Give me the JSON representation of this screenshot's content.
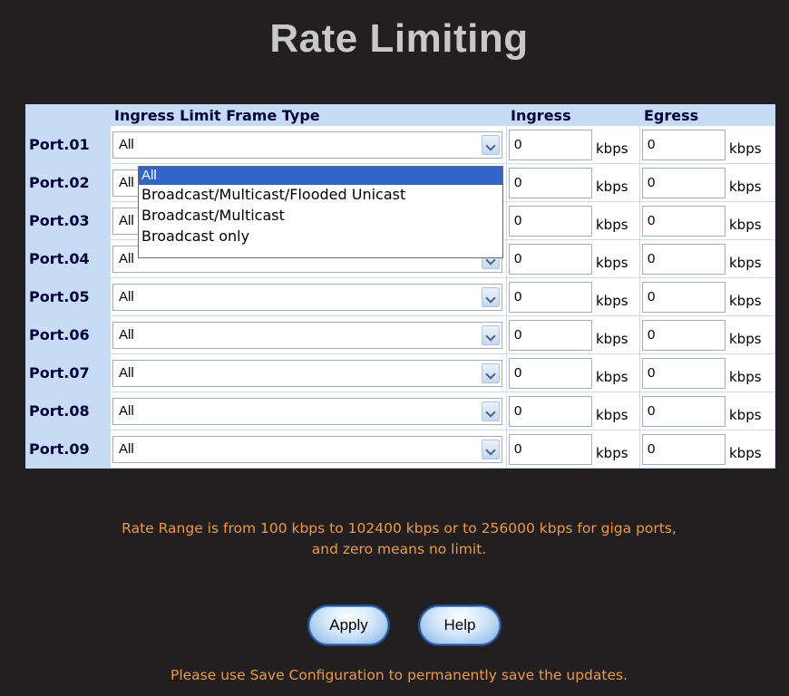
{
  "title": "Rate Limiting",
  "table": {
    "headers": {
      "port": "",
      "frame_type": "Ingress Limit Frame Type",
      "ingress": "Ingress",
      "egress": "Egress"
    },
    "unit": "kbps",
    "rows": [
      {
        "port": "Port.01",
        "frame_type": "All",
        "ingress": "0",
        "egress": "0"
      },
      {
        "port": "Port.02",
        "frame_type": "All",
        "ingress": "0",
        "egress": "0"
      },
      {
        "port": "Port.03",
        "frame_type": "All",
        "ingress": "0",
        "egress": "0"
      },
      {
        "port": "Port.04",
        "frame_type": "All",
        "ingress": "0",
        "egress": "0"
      },
      {
        "port": "Port.05",
        "frame_type": "All",
        "ingress": "0",
        "egress": "0"
      },
      {
        "port": "Port.06",
        "frame_type": "All",
        "ingress": "0",
        "egress": "0"
      },
      {
        "port": "Port.07",
        "frame_type": "All",
        "ingress": "0",
        "egress": "0"
      },
      {
        "port": "Port.08",
        "frame_type": "All",
        "ingress": "0",
        "egress": "0"
      },
      {
        "port": "Port.09",
        "frame_type": "All",
        "ingress": "0",
        "egress": "0"
      }
    ]
  },
  "dropdown": {
    "open_for_row": 0,
    "options": [
      "All",
      "Broadcast/Multicast/Flooded Unicast",
      "Broadcast/Multicast",
      "Broadcast only"
    ],
    "selected_index": 0
  },
  "note_line1": "Rate Range is from 100 kbps to 102400 kbps or to 256000 kbps for giga ports,",
  "note_line2": "and zero means no limit.",
  "buttons": {
    "apply": "Apply",
    "help": "Help"
  },
  "footer": "Please use Save Configuration to permanently save the updates.",
  "colors": {
    "background": "#231f20",
    "header_cell": "#c7dcf4",
    "note_text": "#e89a4a",
    "selected_option": "#3165c8"
  }
}
